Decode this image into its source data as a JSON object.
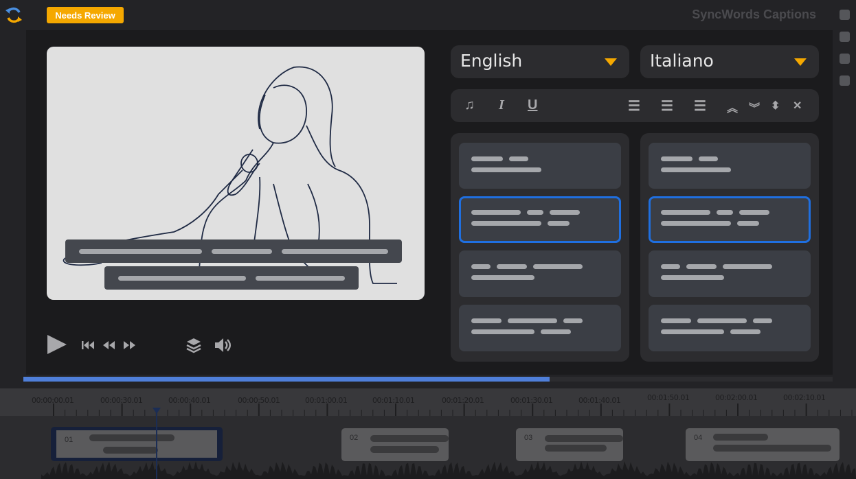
{
  "header": {
    "status_badge": "Needs Review",
    "app_title": "SyncWords Captions"
  },
  "languages": {
    "source": "English",
    "target": "Italiano"
  },
  "toolbar": {
    "icons": [
      "music-note-icon",
      "italic-icon",
      "underline-icon",
      "align-left-icon",
      "align-center-icon",
      "align-right-icon",
      "move-up-icon",
      "move-down-icon",
      "expand-icon",
      "collapse-icon"
    ]
  },
  "player": {
    "icons": [
      "play-icon",
      "skip-back-icon",
      "rewind-icon",
      "fast-forward-icon",
      "layers-icon",
      "volume-icon"
    ],
    "progress_percent": 65
  },
  "timeline": {
    "ticks": [
      "00:00:00.01",
      "00:00:30.01",
      "00:00:40.01",
      "00:00:50.01",
      "00:01:00.01",
      "00:01:10.01",
      "00:01:20.01",
      "00:01:30.01",
      "00:01:40.01",
      "00:01:50.01",
      "00:02:00.01",
      "00:02:10.01"
    ],
    "segments": [
      {
        "id": "01"
      },
      {
        "id": "02"
      },
      {
        "id": "03"
      },
      {
        "id": "04"
      }
    ]
  },
  "colors": {
    "accent": "#f5a800",
    "selection": "#1f6fe0",
    "progress": "#4f7fd9"
  }
}
